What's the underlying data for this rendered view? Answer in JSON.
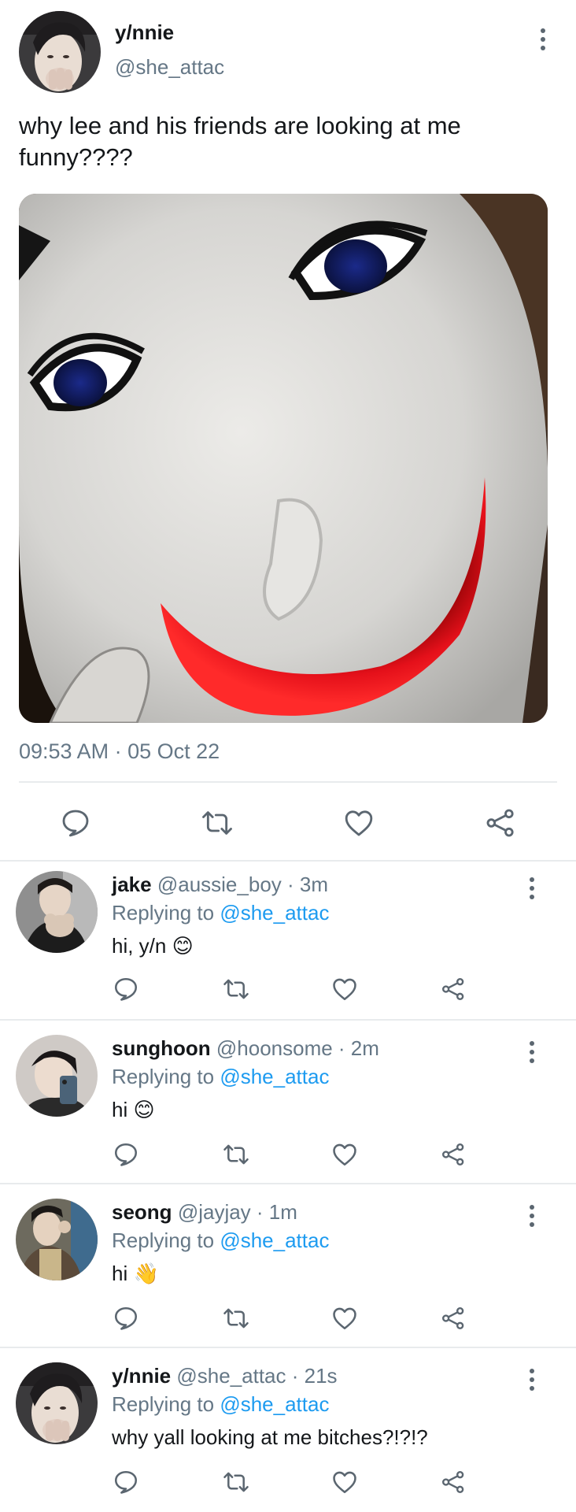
{
  "tweet": {
    "display_name": "y/nnie",
    "handle": "@she_attac",
    "text": "why lee and his friends are looking at me funny????",
    "timestamp": "09:53 AM · 05 Oct 22"
  },
  "replies": [
    {
      "display_name": "jake",
      "handle": "@aussie_boy",
      "time": "· 3m",
      "replying_prefix": "Replying to",
      "replying_to": "@she_attac",
      "text": "hi, y/n",
      "emoji": "😊"
    },
    {
      "display_name": "sunghoon",
      "handle": "@hoonsome",
      "time": "· 2m",
      "replying_prefix": "Replying to",
      "replying_to": "@she_attac",
      "text": "hi",
      "emoji": "😊"
    },
    {
      "display_name": "seong",
      "handle": "@jayjay",
      "time": "· 1m",
      "replying_prefix": "Replying to",
      "replying_to": "@she_attac",
      "text": "hi",
      "emoji": "👋"
    },
    {
      "display_name": "y/nnie",
      "handle": "@she_attac",
      "time": "· 21s",
      "replying_prefix": "Replying to",
      "replying_to": "@she_attac",
      "text": "why yall looking at me bitches?!?!?",
      "emoji": ""
    }
  ],
  "icons": {
    "reply": "comment-bubble-icon",
    "retweet": "retweet-icon",
    "like": "heart-icon",
    "share": "share-icon",
    "more": "more-vertical-icon"
  },
  "colors": {
    "link": "#1d9bf0",
    "muted": "#657786",
    "icon": "#5b6670",
    "divider": "#e8ebed"
  }
}
